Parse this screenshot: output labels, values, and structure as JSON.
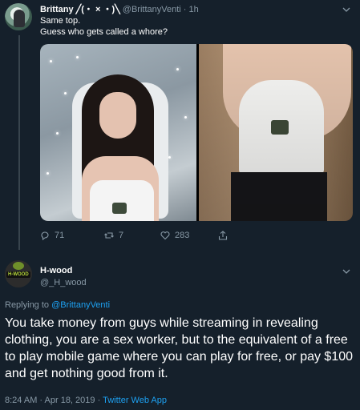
{
  "tweet1": {
    "display_name": "Brittany ╱(・ × ・)╲",
    "handle": "@BrittanyVenti",
    "separator": "·",
    "time": "1h",
    "line1": "Same top.",
    "line2": "Guess who gets called a whore?",
    "actions": {
      "replies": "71",
      "retweets": "7",
      "likes": "283"
    }
  },
  "tweet2": {
    "display_name": "H-wood",
    "handle": "@_H_wood",
    "avatar_text": "H-WOOD",
    "replying_prefix": "Replying to",
    "replying_handle": "@BrittanyVenti",
    "body": "You take money from guys while streaming in revealing clothing, you are a sex worker, but to the equivalent of a free to play mobile game where you can play for free, or pay $100 and get nothing good from it.",
    "timestamp": "8:24 AM · Apr 18, 2019 · ",
    "app": "Twitter Web App"
  },
  "icons": {
    "chevron": "chevron-down-icon",
    "reply": "reply-icon",
    "retweet": "retweet-icon",
    "like": "heart-icon",
    "share": "share-icon"
  },
  "colors": {
    "background": "#15202b",
    "muted": "#8899a6",
    "accent": "#1da1f2",
    "divider": "#38444d"
  }
}
